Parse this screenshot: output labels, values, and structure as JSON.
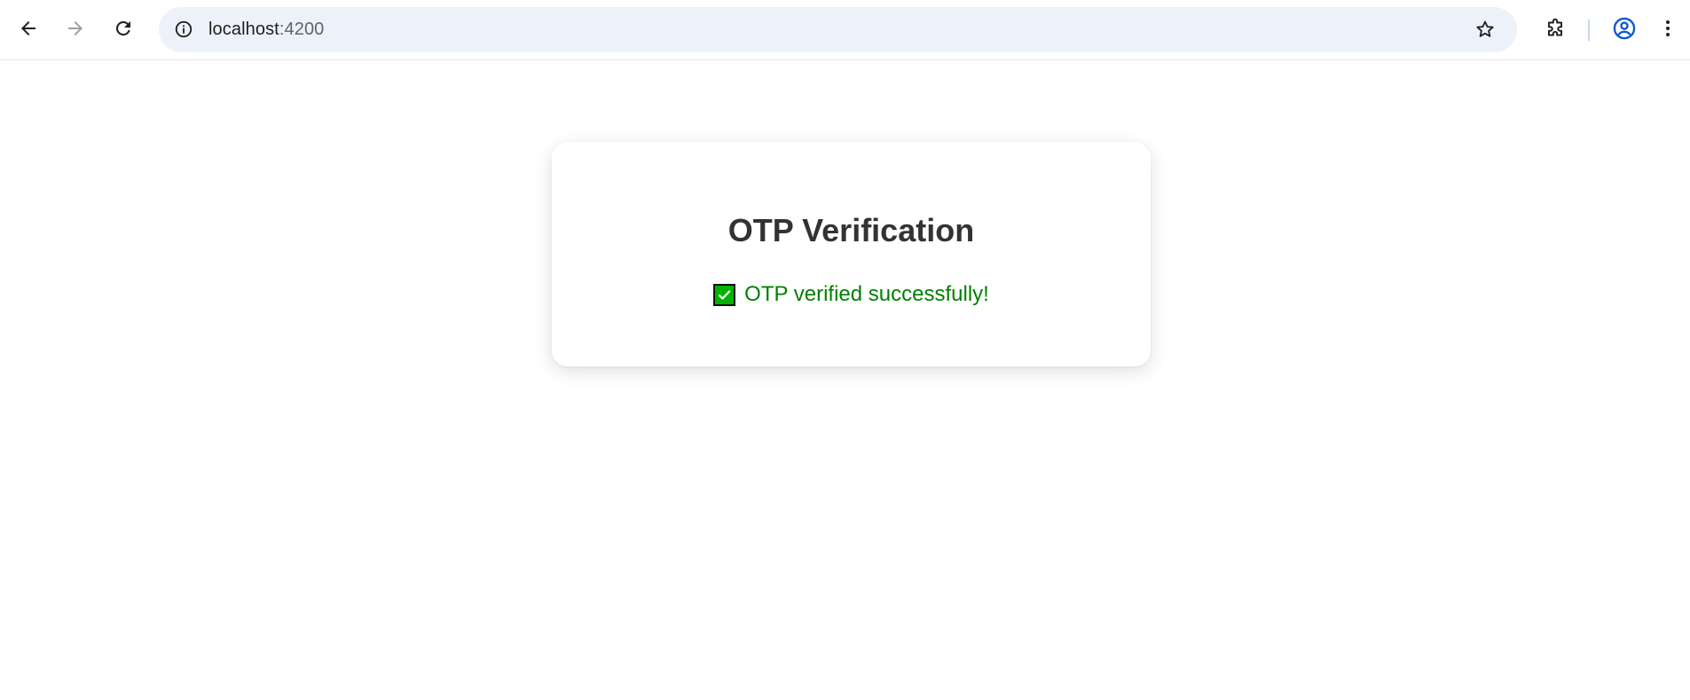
{
  "browser": {
    "url_host": "localhost",
    "url_port": ":4200",
    "icons": {
      "back": "arrow-left-icon",
      "forward": "arrow-right-icon",
      "reload": "reload-icon",
      "site_info": "info-icon",
      "bookmark": "star-icon",
      "extensions": "puzzle-icon",
      "profile": "account-circle-icon",
      "menu": "kebab-menu-icon"
    }
  },
  "card": {
    "title": "OTP Verification",
    "status_icon": "check-mark-icon",
    "status_message": "OTP verified successfully!"
  },
  "colors": {
    "success_text": "#008000",
    "check_fill": "#00b300",
    "title_text": "#333333",
    "omnibox_bg": "#edf2fa",
    "profile_accent": "#0b57d0"
  }
}
